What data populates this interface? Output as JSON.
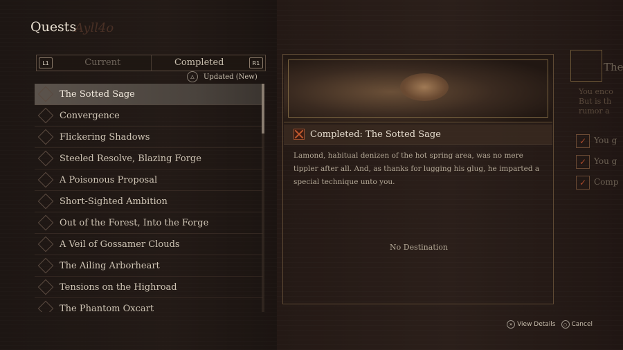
{
  "header": {
    "title": "Quests",
    "title_deco": "Ayll4o"
  },
  "tabs": {
    "left_button": "L1",
    "right_button": "R1",
    "current_label": "Current",
    "completed_label": "Completed"
  },
  "sort": {
    "button_glyph": "△",
    "label": "Updated (New)"
  },
  "quests": [
    {
      "label": "The Sotted Sage",
      "selected": true
    },
    {
      "label": "Convergence"
    },
    {
      "label": "Flickering Shadows"
    },
    {
      "label": "Steeled Resolve, Blazing Forge"
    },
    {
      "label": "A Poisonous Proposal"
    },
    {
      "label": "Short-Sighted Ambition"
    },
    {
      "label": "Out of the Forest, Into the Forge"
    },
    {
      "label": "A Veil of Gossamer Clouds"
    },
    {
      "label": "The Ailing Arborheart"
    },
    {
      "label": "Tensions on the Highroad"
    },
    {
      "label": "The Phantom Oxcart"
    }
  ],
  "detail": {
    "title": "Completed: The Sotted Sage",
    "description": "Lamond, habitual denizen of the hot spring area, was no mere tippler after all. And, as thanks for lugging his glug, he imparted a special technique unto you.",
    "destination": "No Destination"
  },
  "side_panel": {
    "title": "The",
    "text_lines": [
      "You enco",
      "But is th",
      "rumor a"
    ],
    "checks": [
      "You g",
      "You g",
      "Comp"
    ]
  },
  "footer": {
    "view_glyph": "✕",
    "view_label": "View Details",
    "cancel_glyph": "○",
    "cancel_label": "Cancel"
  },
  "colors": {
    "accent_red": "#c25a2e",
    "selected_row": "#5b534c"
  }
}
